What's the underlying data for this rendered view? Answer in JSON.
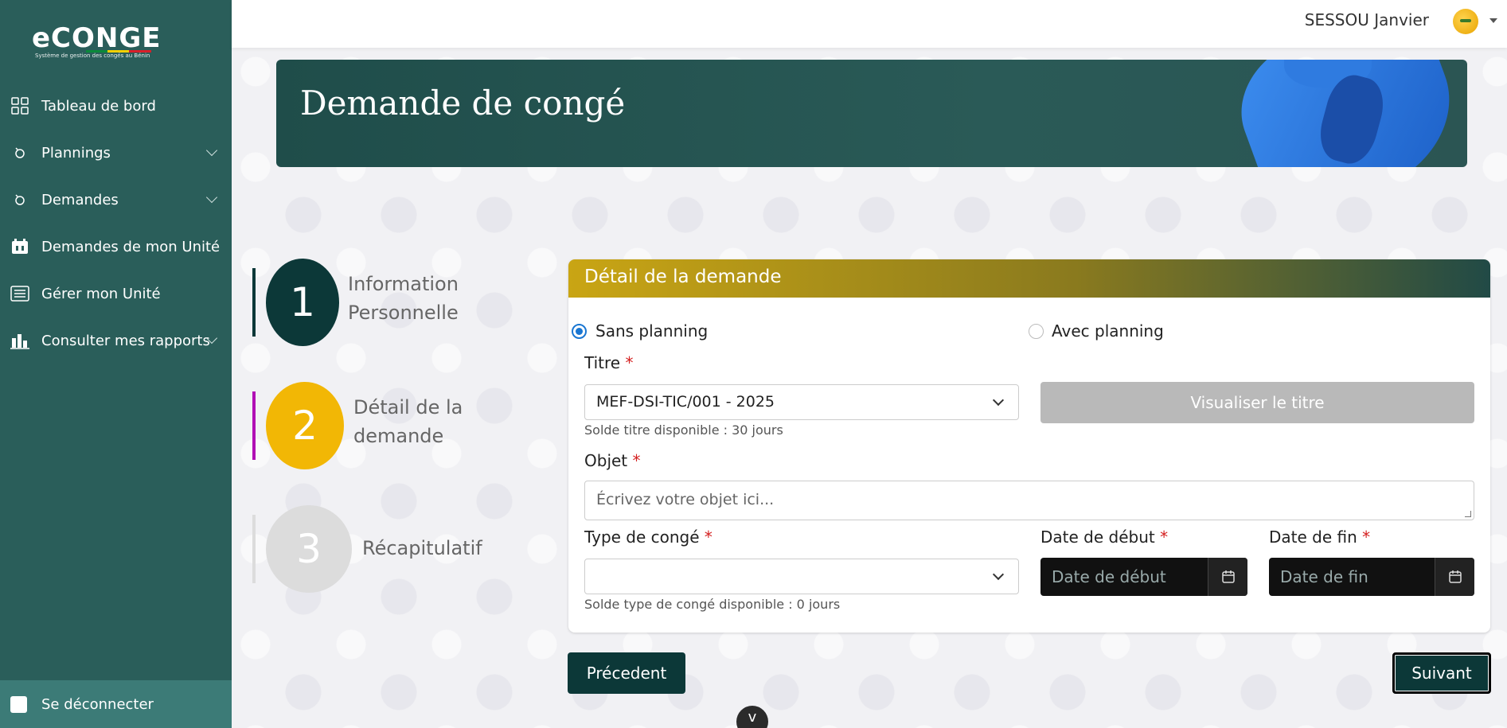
{
  "sidebar": {
    "logo": {
      "title": "eCONGE",
      "subtitle": "Système de gestion des congés au Bénin"
    },
    "items": [
      {
        "label": "Tableau de bord",
        "icon": "grid-icon"
      },
      {
        "label": "Plannings",
        "icon": "planning-icon"
      },
      {
        "label": "Demandes",
        "icon": "request-icon"
      },
      {
        "label": "Demandes de mon Unité",
        "icon": "building-icon"
      },
      {
        "label": "Gérer mon Unité",
        "icon": "list-icon"
      },
      {
        "label": "Consulter mes rapports",
        "icon": "chart-icon"
      }
    ],
    "logout": "Se déconnecter"
  },
  "header": {
    "user_name": "SESSOU Janvier"
  },
  "banner": {
    "title": "Demande de congé"
  },
  "steps": [
    {
      "number": "1",
      "label_line1": "Information",
      "label_line2": "Personnelle",
      "color": "#0c3838",
      "bar_color": "#0c3838"
    },
    {
      "number": "2",
      "label_line1": "Détail de la",
      "label_line2": "demande",
      "color": "#f2b705",
      "bar_color": "#b10fb5"
    },
    {
      "number": "3",
      "label_line1": "Récapitulatif",
      "label_line2": "",
      "color": "#dcdcdc",
      "bar_color": "#dcdcdc"
    }
  ],
  "form": {
    "title": "Détail de la demande",
    "radio_sans": "Sans planning",
    "radio_avec": "Avec planning",
    "titre_label": "Titre",
    "titre_value": "MEF-DSI-TIC/001 - 2025",
    "visualiser_button": "Visualiser le titre",
    "solde_titre": "Solde titre disponible : 30 jours",
    "objet_label": "Objet",
    "objet_placeholder": "Écrivez votre objet ici...",
    "type_label": "Type de congé",
    "type_value": "",
    "solde_type": "Solde type de congé disponible : 0 jours",
    "date_debut_label": "Date de début",
    "date_debut_placeholder": "Date de début",
    "date_fin_label": "Date de fin",
    "date_fin_placeholder": "Date de fin",
    "required_mark": "*"
  },
  "buttons": {
    "previous": "Précedent",
    "next": "Suivant",
    "scroll": "v"
  }
}
